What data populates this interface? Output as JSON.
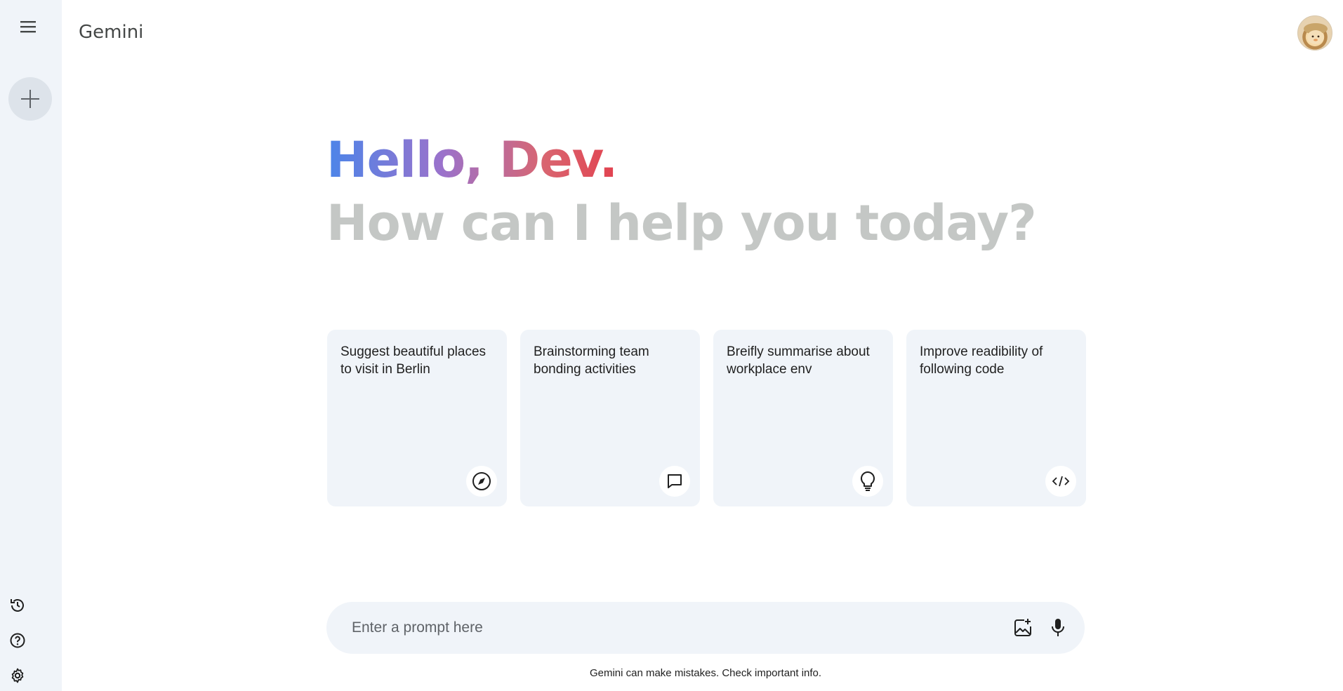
{
  "app": {
    "title": "Gemini"
  },
  "sidebar": {
    "menu_icon": "menu-icon",
    "new_chat_icon": "plus-icon",
    "bottom_icons": [
      "history-icon",
      "help-icon",
      "settings-icon"
    ]
  },
  "greeting": {
    "hello": "Hello, Dev.",
    "subtitle": "How can I help you today?"
  },
  "cards": [
    {
      "text": "Suggest beautiful places to visit in Berlin",
      "icon": "compass-icon"
    },
    {
      "text": "Brainstorming team bonding activities",
      "icon": "chat-bubble-icon"
    },
    {
      "text": "Breifly summarise about workplace env",
      "icon": "lightbulb-icon"
    },
    {
      "text": "Improve readibility of following code",
      "icon": "code-icon"
    }
  ],
  "prompt": {
    "placeholder": "Enter a prompt here",
    "value": "",
    "actions": [
      "add-image-icon",
      "microphone-icon"
    ]
  },
  "footer": {
    "disclaimer": "Gemini can make mistakes. Check important info."
  },
  "colors": {
    "sidebar_bg": "#f0f4f9",
    "gradient": [
      "#4b85e9",
      "#9b72cb",
      "#d96570",
      "#e2424f"
    ],
    "subtitle": "#c4c7c5"
  }
}
